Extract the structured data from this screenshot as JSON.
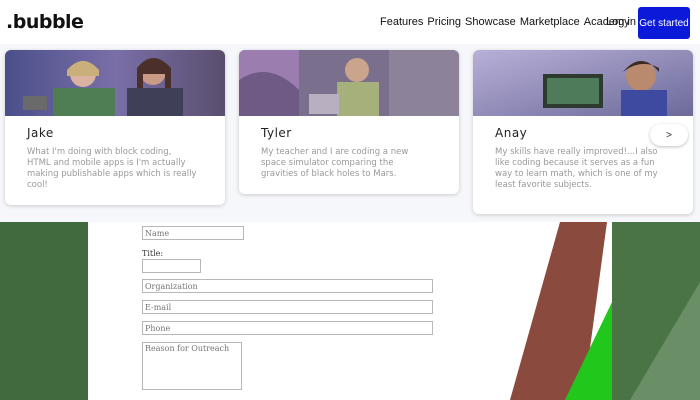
{
  "header": {
    "logo": ".bubble",
    "nav": [
      "Features",
      "Pricing",
      "Showcase",
      "Marketplace",
      "Academy"
    ],
    "login": "Log in",
    "cta": "Get started"
  },
  "testimonials": [
    {
      "name": "Jake",
      "quote": "What I'm doing with block coding, HTML and mobile apps is I'm actually making publishable apps which is really cool!"
    },
    {
      "name": "Tyler",
      "quote": "My teacher and I are coding a new space simulator comparing the gravities of black holes to Mars."
    },
    {
      "name": "Anay",
      "quote": "My skills have really improved!...I also like coding because it serves as a fun way to learn math, which is one of my least favorite subjects."
    }
  ],
  "next_button": ">",
  "form": {
    "name_placeholder": "Name",
    "title_label": "Title:",
    "title_value": "",
    "organization_placeholder": "Organization",
    "email_placeholder": "E-mail",
    "phone_placeholder": "Phone",
    "reason_placeholder": "Reason for Outreach"
  }
}
